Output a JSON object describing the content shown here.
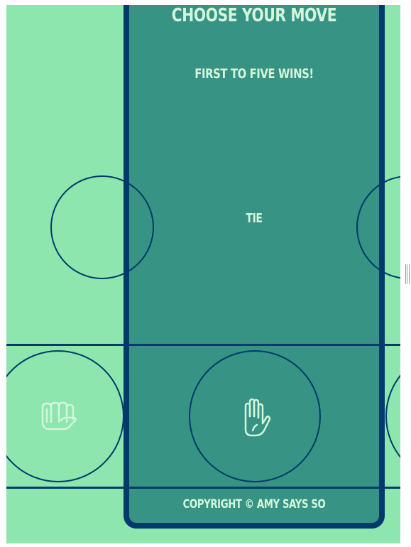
{
  "game": {
    "title": "Choose your move",
    "subtitle": "First to five wins!",
    "result": "Tie",
    "footer": "Copyright © Amy Says So"
  },
  "colors": {
    "background": "#8ce6ad",
    "panel": "#379383",
    "border": "#013a6b",
    "text": "#d4f7dc"
  },
  "moves": [
    {
      "name": "rock",
      "icon": "fist-icon"
    },
    {
      "name": "paper",
      "icon": "raised-hand-icon"
    }
  ]
}
